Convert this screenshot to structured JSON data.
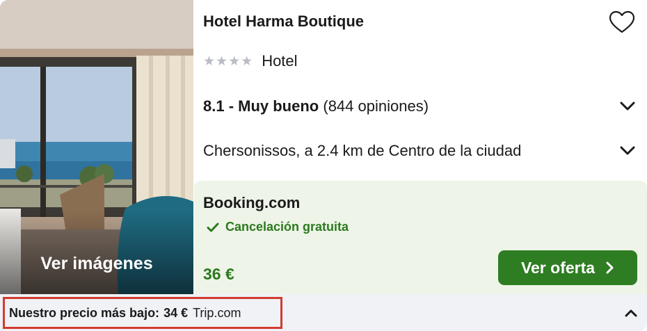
{
  "hotel": {
    "name": "Hotel Harma Boutique",
    "star_count": 4,
    "type": "Hotel",
    "rating_score_label": "8.1 - Muy bueno",
    "rating_reviews": "(844 opiniones)",
    "location": "Chersonissos, a 2.4 km de Centro de la ciudad"
  },
  "photo": {
    "see_images_label": "Ver imágenes"
  },
  "offer": {
    "provider": "Booking.com",
    "cancellation": "Cancelación gratuita",
    "price": "36 €",
    "button_label": "Ver oferta"
  },
  "bottom_bar": {
    "lowest_label": "Nuestro precio más bajo:",
    "lowest_price": "34 €",
    "lowest_source": "Trip.com"
  },
  "colors": {
    "accent_green": "#2e7d22",
    "offer_background": "#eef4e8",
    "highlight_border": "#d23b30",
    "star_gray": "#b9bcc4"
  },
  "icons": {
    "favorite": "heart-outline-icon",
    "expand": "chevron-down-icon",
    "collapse": "chevron-up-icon",
    "check": "check-icon",
    "arrow": "chevron-right-icon"
  }
}
